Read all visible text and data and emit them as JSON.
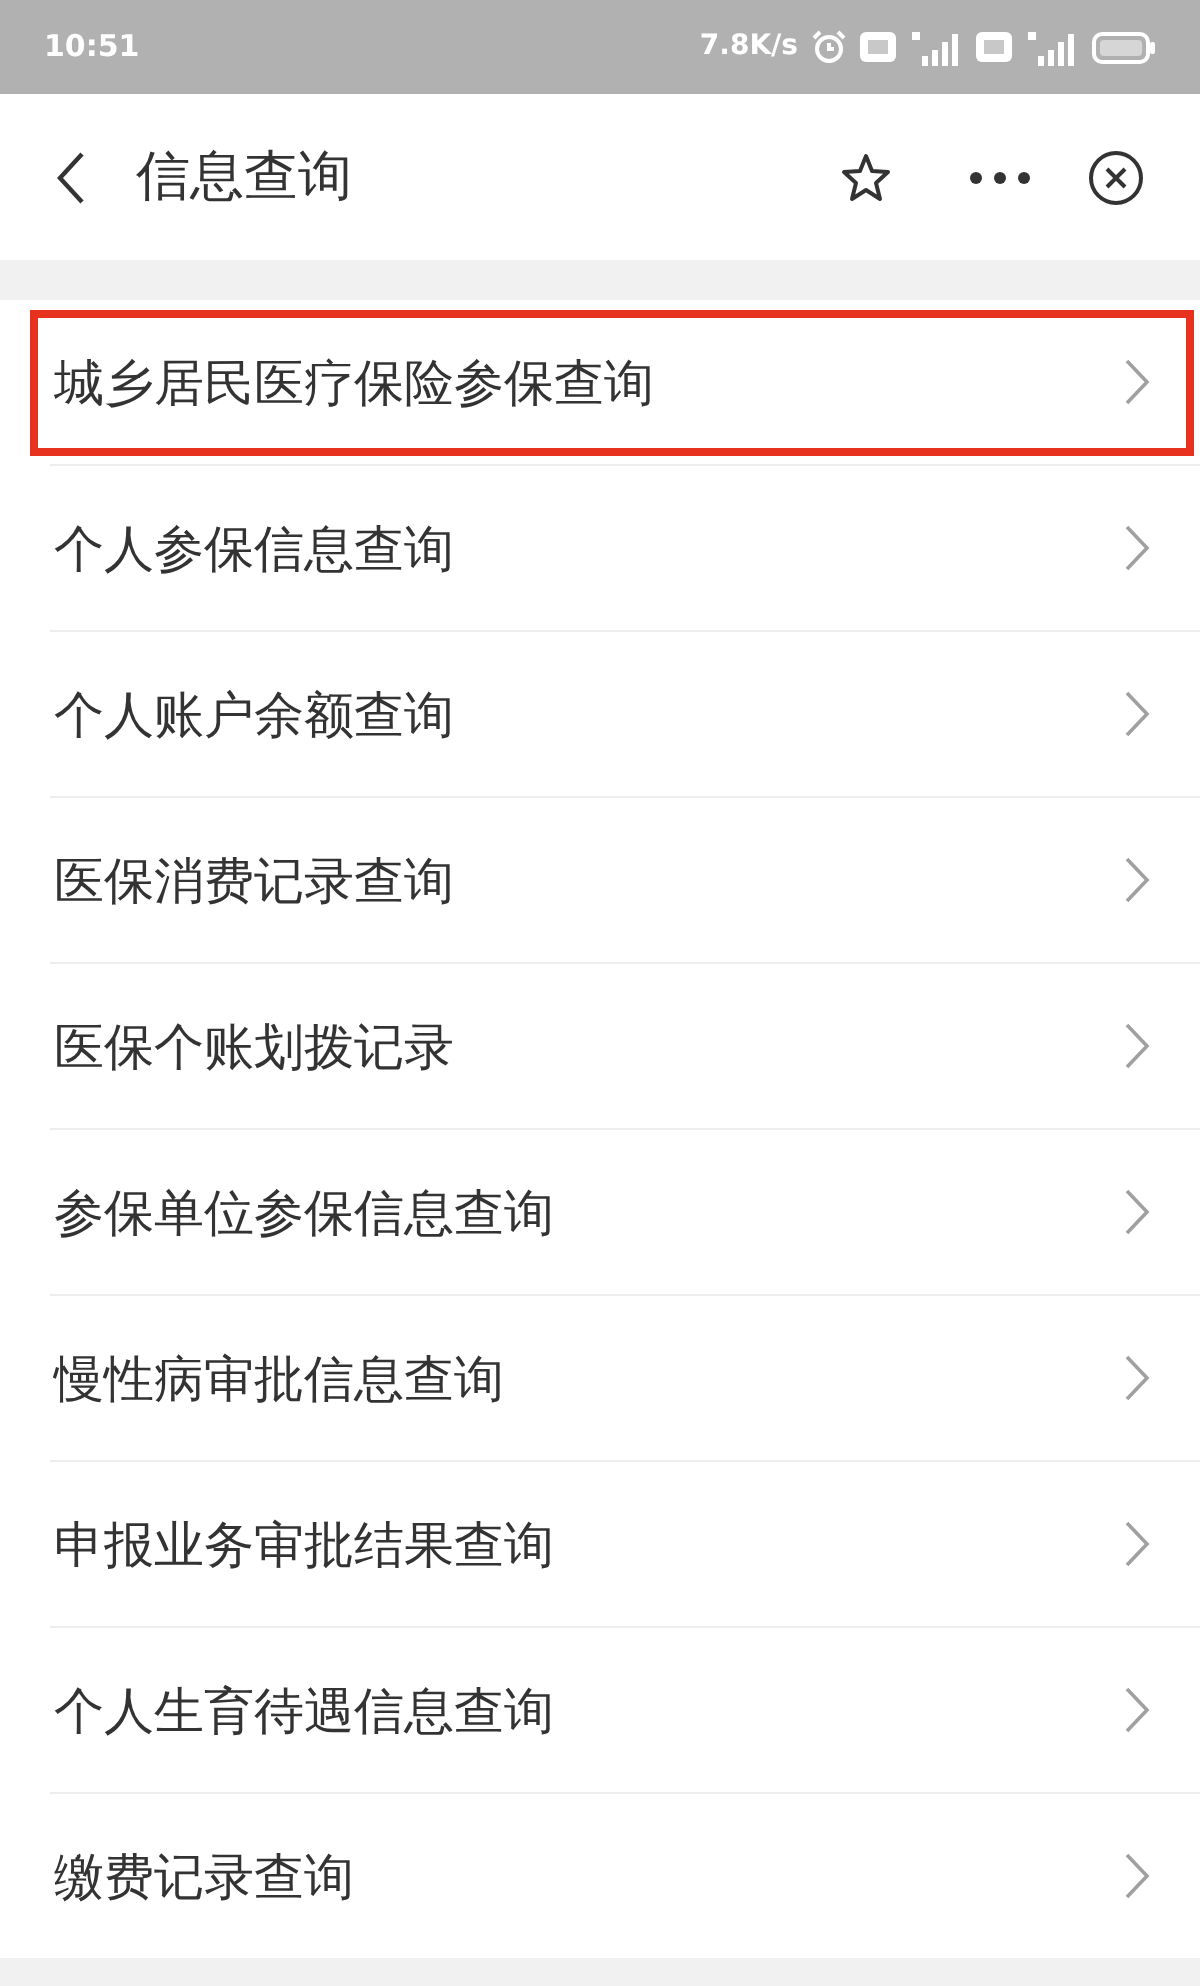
{
  "status_bar": {
    "time": "10:51",
    "network_speed": "7.8K/s"
  },
  "header": {
    "title": "信息查询"
  },
  "menu_items": [
    {
      "label": "城乡居民医疗保险参保查询",
      "highlighted": true
    },
    {
      "label": "个人参保信息查询",
      "highlighted": false
    },
    {
      "label": "个人账户余额查询",
      "highlighted": false
    },
    {
      "label": "医保消费记录查询",
      "highlighted": false
    },
    {
      "label": "医保个账划拨记录",
      "highlighted": false
    },
    {
      "label": "参保单位参保信息查询",
      "highlighted": false
    },
    {
      "label": "慢性病审批信息查询",
      "highlighted": false
    },
    {
      "label": "申报业务审批结果查询",
      "highlighted": false
    },
    {
      "label": "个人生育待遇信息查询",
      "highlighted": false
    },
    {
      "label": "缴费记录查询",
      "highlighted": false
    }
  ]
}
